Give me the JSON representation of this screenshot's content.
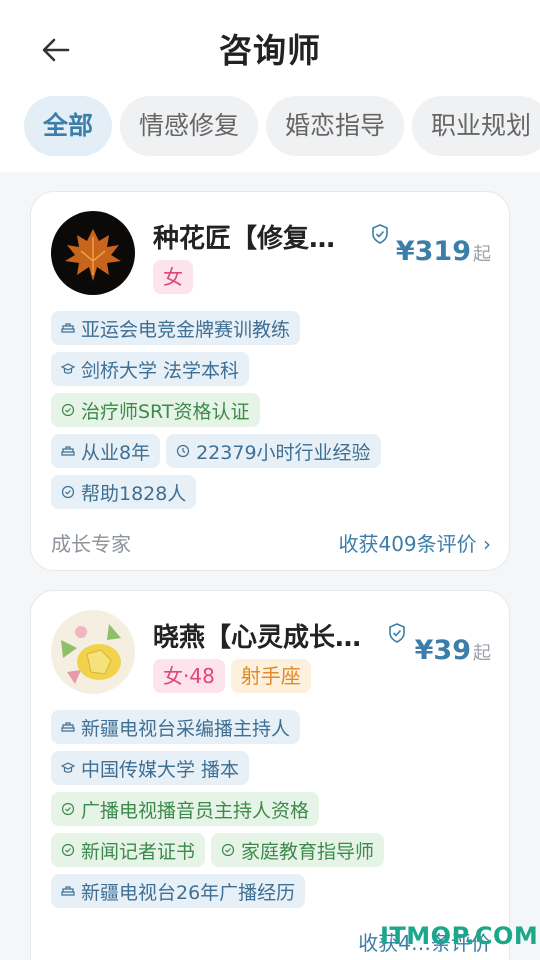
{
  "header": {
    "title": "咨询师"
  },
  "tabs": [
    {
      "label": "全部",
      "active": true
    },
    {
      "label": "情感修复"
    },
    {
      "label": "婚恋指导"
    },
    {
      "label": "职业规划"
    }
  ],
  "counselors": [
    {
      "name": "种花匠【修复…",
      "price": "¥319",
      "price_unit": "起",
      "badges": [
        "女"
      ],
      "tags": [
        {
          "icon": "hat-icon",
          "text": "亚运会电竞金牌赛训教练"
        },
        {
          "icon": "graduation-cap-icon",
          "text": "剑桥大学 法学本科"
        },
        {
          "icon": "check-circle-icon",
          "text": "治疗师SRT资格认证"
        },
        {
          "icon": "hat-icon",
          "text": "从业8年"
        },
        {
          "icon": "clock-icon",
          "text": "22379小时行业经验"
        },
        {
          "icon": "check-circle-icon",
          "text": "帮助1828人"
        }
      ],
      "footer_left": "成长专家",
      "footer_right": "收获409条评价 ›"
    },
    {
      "name": "晓燕【心灵成长…",
      "price": "¥39",
      "price_unit": "起",
      "badges": [
        "女·48",
        "射手座"
      ],
      "tags": [
        {
          "icon": "hat-icon",
          "text": "新疆电视台采编播主持人"
        },
        {
          "icon": "graduation-cap-icon",
          "text": "中国传媒大学 播本"
        },
        {
          "icon": "check-circle-icon",
          "text": "广播电视播音员主持人资格"
        },
        {
          "icon": "check-circle-icon",
          "text": "新闻记者证书"
        },
        {
          "icon": "check-circle-icon",
          "text": "家庭教育指导师"
        },
        {
          "icon": "hat-icon",
          "text": "新疆电视台26年广播经历"
        }
      ],
      "footer_right": "收获4…条评价"
    }
  ],
  "watermark": "ITMOP.COM"
}
